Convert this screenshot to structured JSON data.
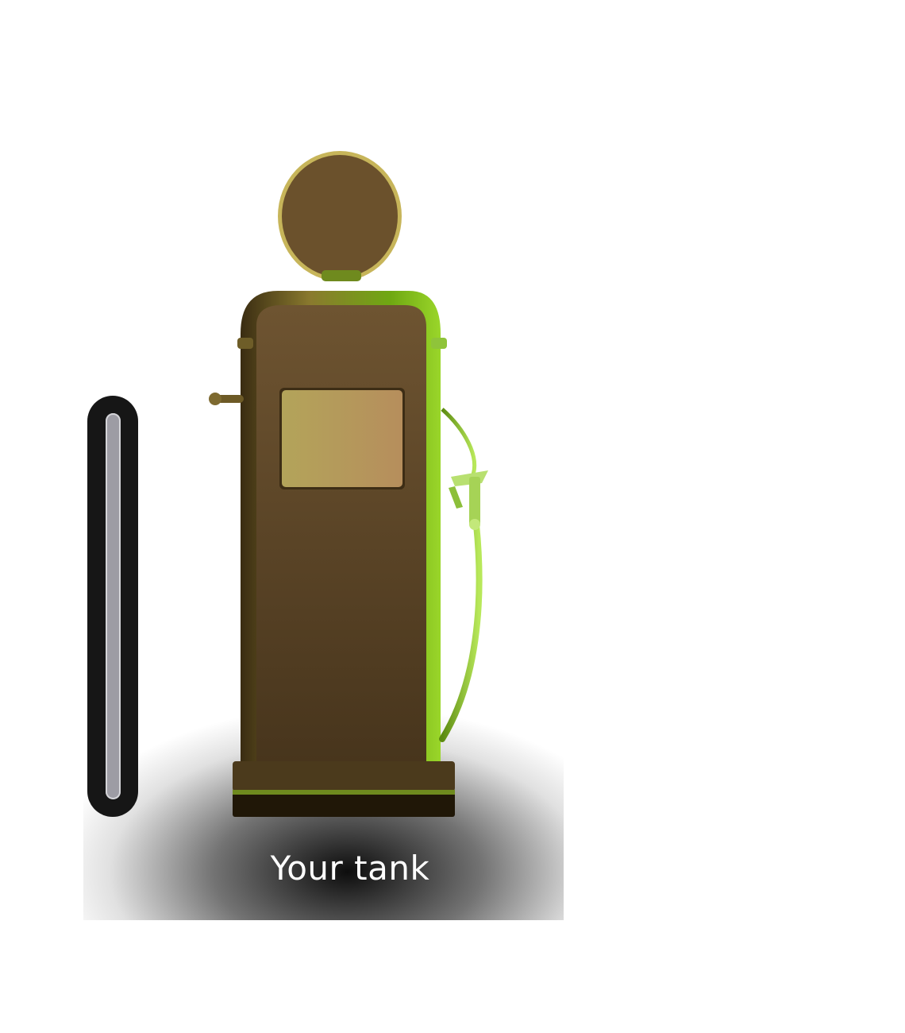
{
  "tank": {
    "label": "Your tank",
    "fill_level": 0
  },
  "icons": {
    "pump": "fuel-pump-icon",
    "gauge": "fuel-level-gauge"
  },
  "colors": {
    "pump_body": "#5a4224",
    "pump_trim": "#7fbf1a",
    "display_screen": "#b8a45c",
    "gauge_frame": "#161616",
    "gauge_track": "#9d9ca4",
    "gauge_fill": "#7fbf1a",
    "label_text": "#ffffff"
  }
}
